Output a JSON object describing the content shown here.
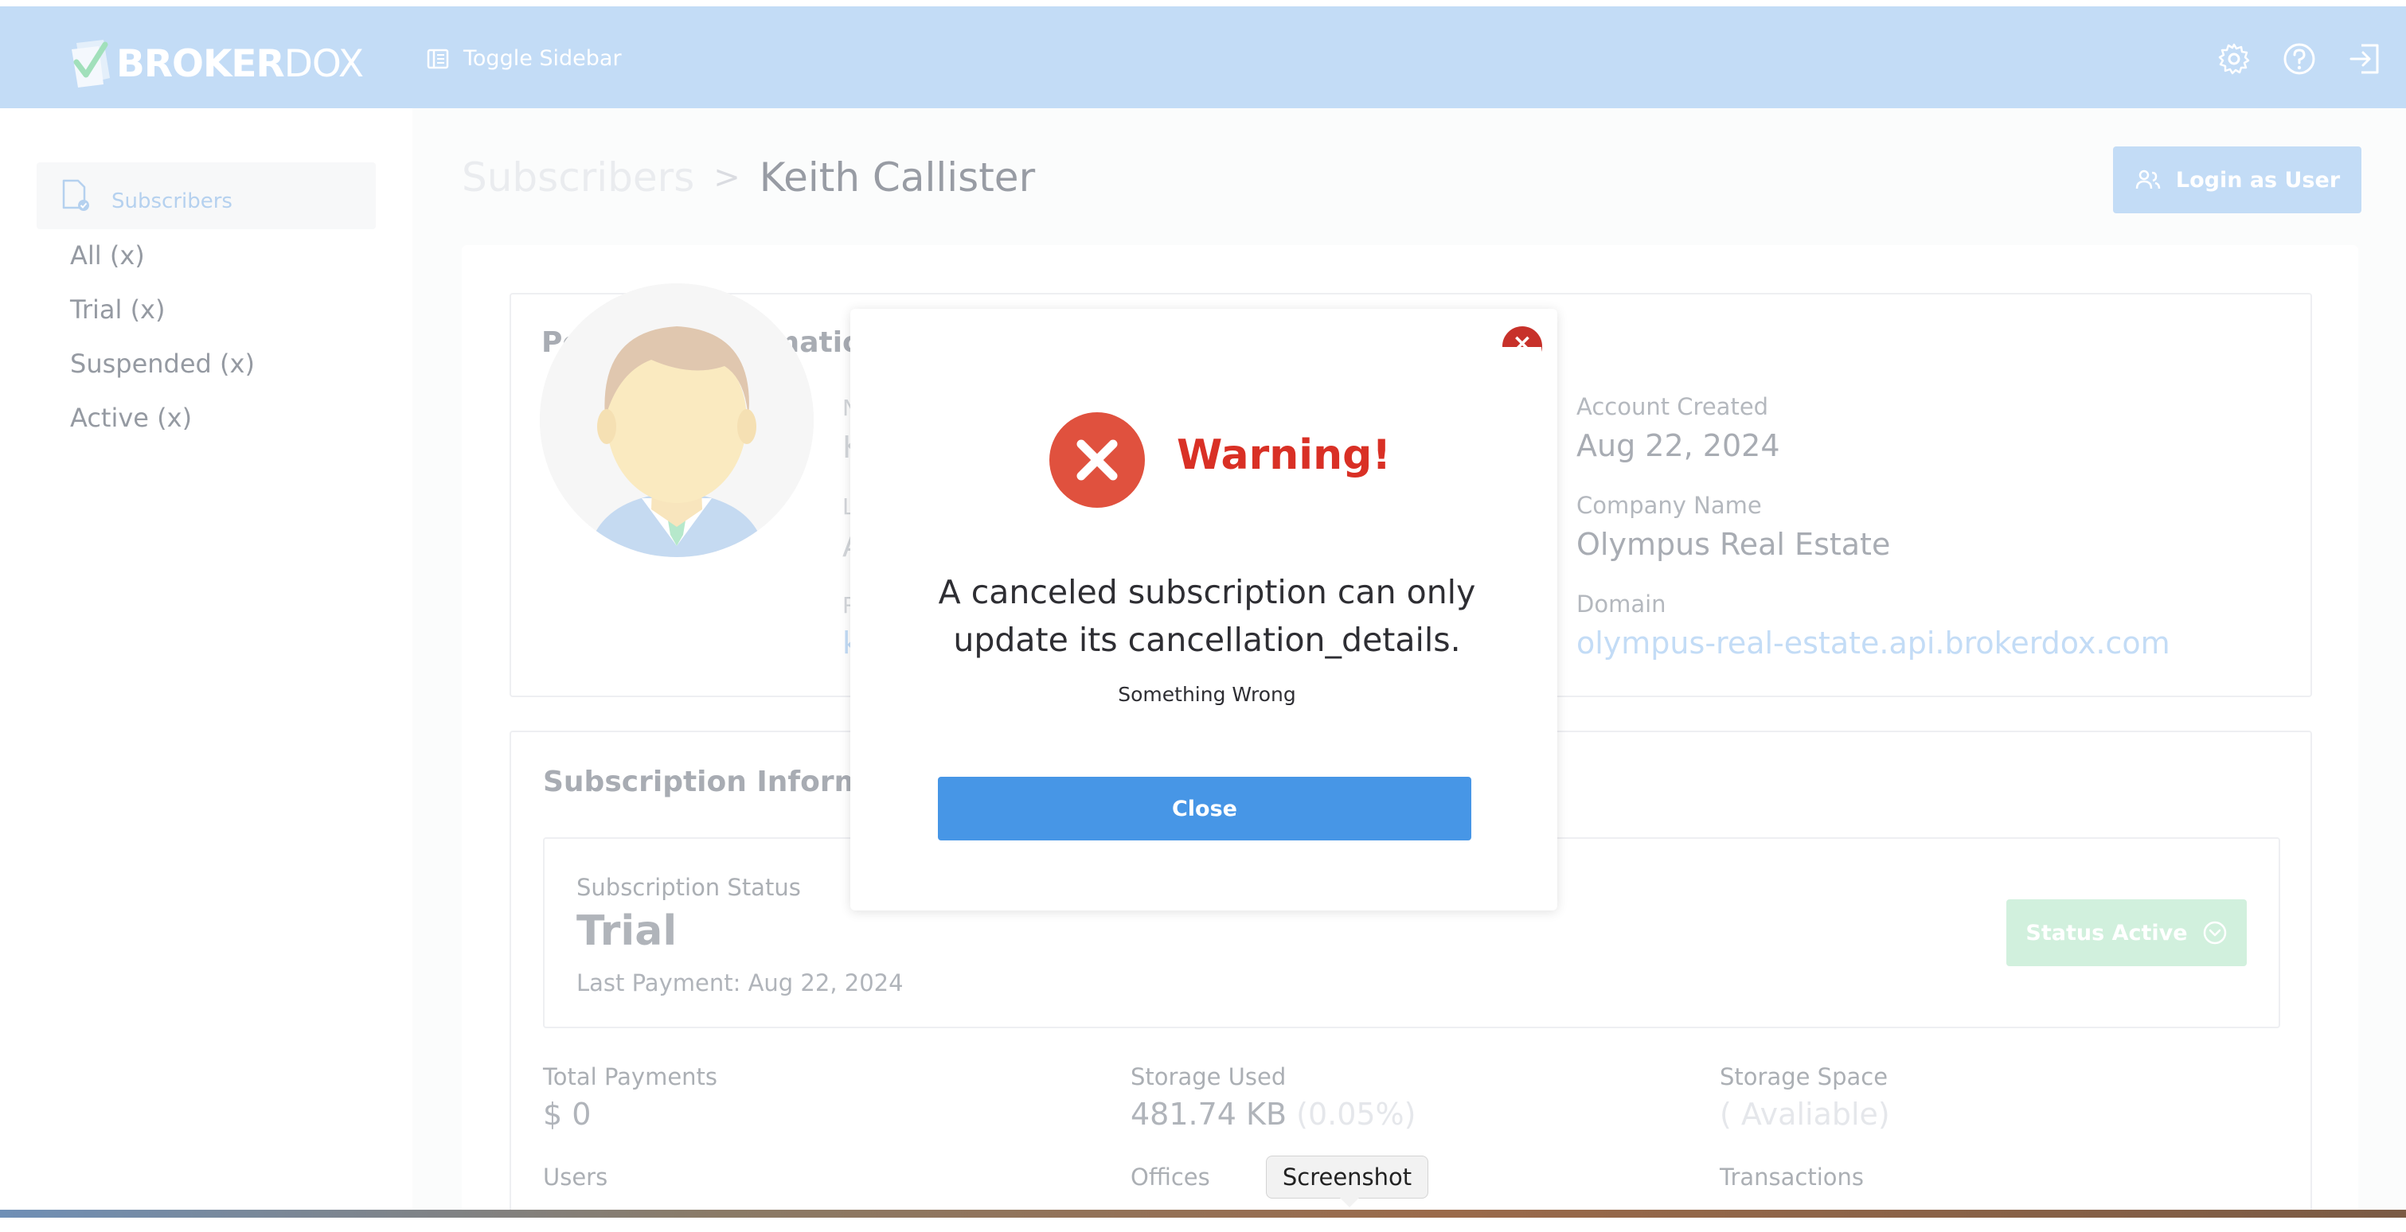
{
  "topbar": {
    "logo_bold": "BROKER",
    "logo_thin": "DOX",
    "toggle_label": "Toggle Sidebar",
    "icons": [
      "gear-icon",
      "help-icon",
      "logout-icon"
    ]
  },
  "sidebar": {
    "active_label": "Subscribers",
    "items": [
      "All (x)",
      "Trial (x)",
      "Suspended (x)",
      "Active (x)"
    ]
  },
  "header": {
    "crumb_parent": "Subscribers",
    "crumb_current": "Keith Callister",
    "login_label": "Login as User"
  },
  "personal": {
    "title": "Personal Information",
    "fragments": [
      "N",
      "K",
      "L",
      "A",
      "R",
      "k"
    ],
    "account_created_label": "Account Created",
    "account_created_value": "Aug 22, 2024",
    "company_label": "Company Name",
    "company_value": "Olympus Real Estate",
    "domain_label": "Domain",
    "domain_value": "olympus-real-estate.api.brokerdox.com"
  },
  "subscription": {
    "title": "Subscription Informa",
    "status_label": "Subscription Status",
    "status_value": "Trial",
    "last_payment": "Last Payment: Aug 22, 2024",
    "status_button": "Status Active"
  },
  "stats": {
    "total_payments_label": "Total Payments",
    "total_payments_value": "$ 0",
    "storage_used_label": "Storage Used",
    "storage_used_value": "481.74 KB",
    "storage_used_percent": "(0.05%)",
    "storage_space_label": "Storage Space",
    "storage_space_value": "( Avaliable)",
    "users_label": "Users",
    "offices_label": "Offices",
    "transactions_label": "Transactions"
  },
  "modal": {
    "title": "Warning!",
    "message": "A canceled subscription can only update its cancellation_details.",
    "subtext": "Something Wrong",
    "close_label": "Close"
  },
  "tooltip": "Screenshot",
  "colors": {
    "topbar": "#a3c9f2",
    "primary": "#4796e6",
    "warning": "#d93025",
    "status_green": "#b9e8cb"
  }
}
